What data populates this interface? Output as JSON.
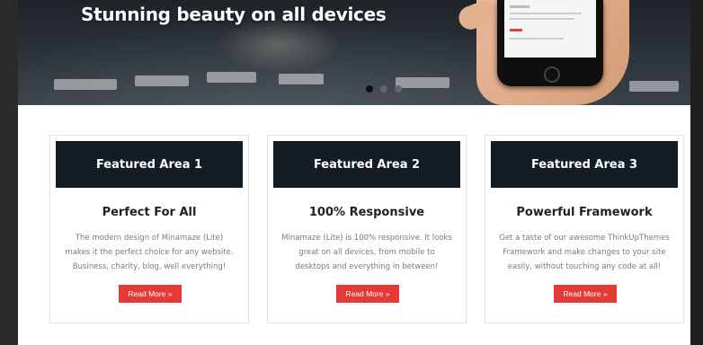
{
  "hero": {
    "title": "Stunning beauty on all devices",
    "slides": 3,
    "active_slide": 1
  },
  "features": [
    {
      "header": "Featured Area 1",
      "title": "Perfect For All",
      "description": "The modern design of Minamaze (Lite) makes it the perfect choice for any website. Business, charity, blog, well everything!",
      "button": "Read More »"
    },
    {
      "header": "Featured Area 2",
      "title": "100% Responsive",
      "description": "Minamaze (Lite) is 100% responsive. It looks great on all devices, from mobile to desktops and everything in between!",
      "button": "Read More »"
    },
    {
      "header": "Featured Area 3",
      "title": "Powerful Framework",
      "description": "Get a taste of our awesome ThinkUpThemes Framework and make changes to your site easily, without touching any code at all!",
      "button": "Read More »"
    }
  ],
  "colors": {
    "header_bg": "#141d24",
    "button_bg": "#e53935"
  }
}
